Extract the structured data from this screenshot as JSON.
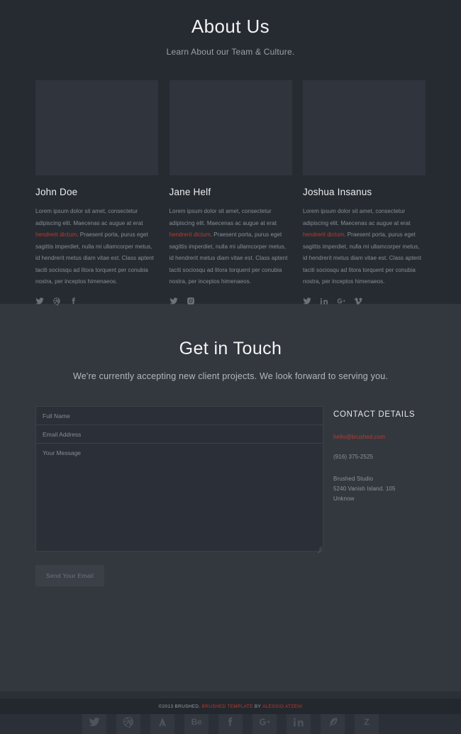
{
  "about": {
    "title": "About Us",
    "subtitle": "Learn About our Team & Culture.",
    "members": [
      {
        "name": "John Doe",
        "bio_before": "Lorem ipsum dolor sit amet, consectetur adipiscing elit. Maecenas ac augue at erat ",
        "bio_link": "hendrerit dictum",
        "bio_after": ". Praesent porta, purus eget sagittis imperdiet, nulla mi ullamcorper metus, id hendrerit metus diam vitae est. Class aptent taciti sociosqu ad litora torquent per conubia nostra, per inceptos himenaeos.",
        "socials": [
          "twitter-icon",
          "dribbble-icon",
          "facebook-icon"
        ]
      },
      {
        "name": "Jane Helf",
        "bio_before": "Lorem ipsum dolor sit amet, consectetur adipiscing elit. Maecenas ac augue at erat ",
        "bio_link": "hendrerit dictum",
        "bio_after": ". Praesent porta, purus eget sagittis imperdiet, nulla mi ullamcorper metus, id hendrerit metus diam vitae est. Class aptent taciti sociosqu ad litora torquent per conubia nostra, per inceptos himenaeos.",
        "socials": [
          "twitter-icon",
          "instagram-icon"
        ]
      },
      {
        "name": "Joshua Insanus",
        "bio_before": "Lorem ipsum dolor sit amet, consectetur adipiscing elit. Maecenas ac augue at erat ",
        "bio_link": "hendrerit dictum",
        "bio_after": ". Praesent porta, purus eget sagittis imperdiet, nulla mi ullamcorper metus, id hendrerit metus diam vitae est. Class aptent taciti sociosqu ad litora torquent per conubia nostra, per inceptos himenaeos.",
        "socials": [
          "twitter-icon",
          "linkedin-icon",
          "googleplus-icon",
          "vimeo-icon"
        ]
      }
    ]
  },
  "contact": {
    "title": "Get in Touch",
    "subtitle": "We're currently accepting new client projects. We look forward to serving you.",
    "form": {
      "name_placeholder": "Full Name",
      "name_value": "",
      "email_placeholder": "Email Address",
      "email_value": "",
      "message_placeholder": "Your Message",
      "message_value": "",
      "submit_label": "Send Your Email"
    },
    "details": {
      "title": "CONTACT DETAILS",
      "email": "hello@brushed.com",
      "phone": "(916) 375-2525",
      "address_line1": "Brushed Studio",
      "address_line2": "5240 Vanish Island. 105",
      "address_line3": "Unknow"
    }
  },
  "footer": {
    "socials": [
      "twitter-icon",
      "dribbble-icon",
      "forrst-icon",
      "behance-icon",
      "facebook-icon",
      "googleplus-icon",
      "linkedin-icon",
      "envato-icon",
      "zerply-icon"
    ],
    "copyright_prefix": "©2013 BRUSHED.",
    "copyright_template": "BRUSHED TEMPLATE",
    "copyright_by": "BY",
    "copyright_author": "ALESSIO ATZENI"
  },
  "colors": {
    "accent_red": "#c0392b",
    "about_bg": "#262b32",
    "contact_bg": "#33383f",
    "footer_bg": "#2b3038",
    "copyright_bg": "#23282e"
  }
}
